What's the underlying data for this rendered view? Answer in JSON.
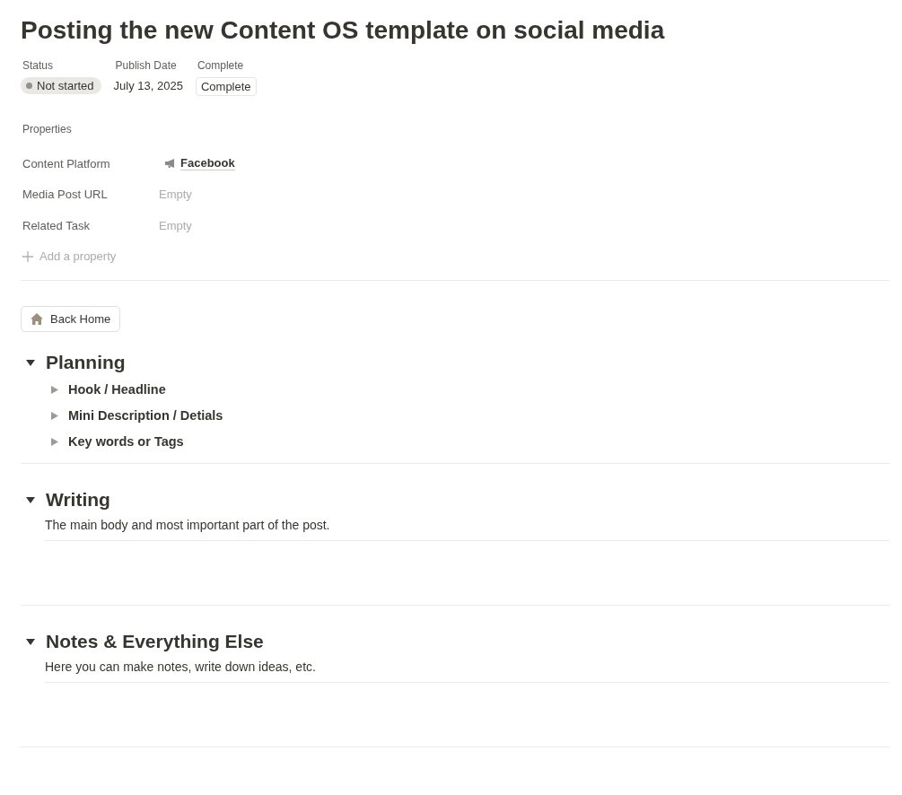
{
  "title": "Posting the new Content OS template on social media",
  "header_properties": [
    {
      "label": "Status",
      "kind": "status",
      "value": "Not started"
    },
    {
      "label": "Publish Date",
      "kind": "text",
      "value": "July 13, 2025"
    },
    {
      "label": "Complete",
      "kind": "chip",
      "value": "Complete"
    }
  ],
  "properties_heading": "Properties",
  "properties": [
    {
      "label": "Content Platform",
      "kind": "link",
      "value": "Facebook"
    },
    {
      "label": "Media Post URL",
      "kind": "empty",
      "value": "Empty"
    },
    {
      "label": "Related Task",
      "kind": "empty",
      "value": "Empty"
    }
  ],
  "add_property": "Add a property",
  "back_button": "Back Home",
  "sections": [
    {
      "heading": "Planning",
      "expanded": true,
      "children": [
        {
          "label": "Hook / Headline",
          "expanded": false
        },
        {
          "label": "Mini Description / Detials",
          "expanded": false
        },
        {
          "label": "Key words or Tags",
          "expanded": false
        }
      ]
    },
    {
      "heading": "Writing",
      "expanded": true,
      "text": "The main body and most important part of the post."
    },
    {
      "heading": "Notes & Everything Else",
      "expanded": true,
      "text": "Here you can make notes, write down ideas, etc."
    }
  ]
}
